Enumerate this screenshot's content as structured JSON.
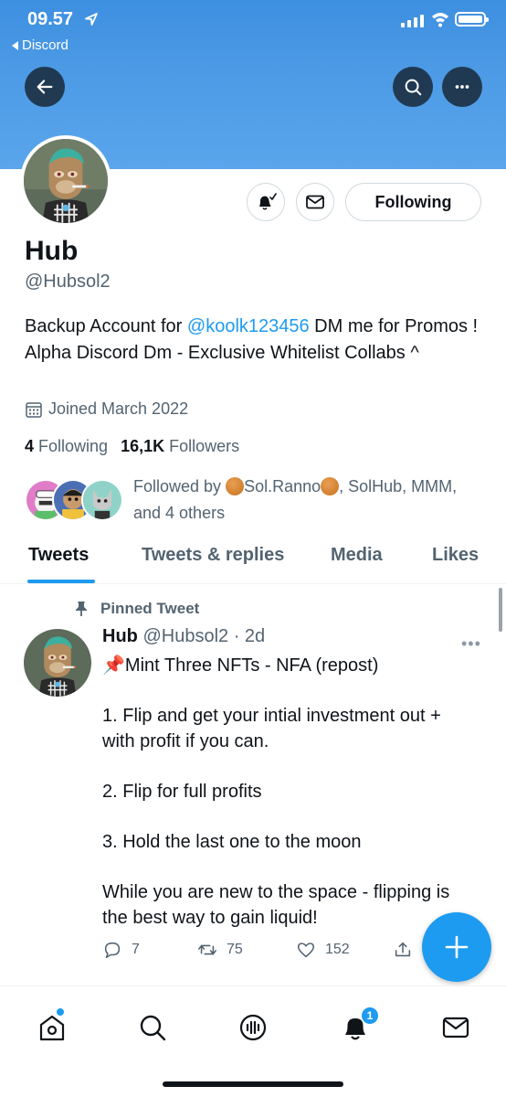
{
  "status_bar": {
    "time": "09.57",
    "back_app": "Discord"
  },
  "colors": {
    "accent": "#1d9bf0",
    "banner": "#4d9be6",
    "text_secondary": "#536471"
  },
  "header": {
    "back_icon": "arrow-left-icon",
    "search_icon": "search-icon",
    "more_icon": "more-icon"
  },
  "profile": {
    "name": "Hub",
    "handle": "@Hubsol2",
    "bio_before": "Backup Account for ",
    "bio_mention": "@koolk123456",
    "bio_after": " DM me for Promos ! Alpha Discord Dm - Exclusive Whitelist Collabs ^",
    "joined": "Joined March 2022",
    "following_count": "4",
    "following_label": "Following",
    "followers_count": "16,1K",
    "followers_label": "Followers",
    "following_button": "Following",
    "followed_by_prefix": "Followed by ",
    "followed_by_name1": "Sol.Ranno",
    "followed_by_rest": ", SolHub, MMM, and 4 others"
  },
  "tabs": [
    {
      "label": "Tweets",
      "active": true
    },
    {
      "label": "Tweets & replies",
      "active": false
    },
    {
      "label": "Media",
      "active": false
    },
    {
      "label": "Likes",
      "active": false
    }
  ],
  "tweet": {
    "pinned_label": "Pinned Tweet",
    "author_name": "Hub",
    "author_meta": "@Hubsol2 · 2d",
    "lines": [
      "📌Mint Three NFTs - NFA (repost)",
      "1. Flip and get your intial investment out + with profit if you can.",
      "2. Flip for full profits",
      "3. Hold the last one to the moon",
      "While you are new to the space - flipping is the best way to gain liquid!"
    ],
    "replies": "7",
    "retweets": "75",
    "likes": "152"
  },
  "bottom_nav": {
    "notifications_badge": "1",
    "items": [
      "home-icon",
      "search-icon",
      "spaces-icon",
      "notifications-icon",
      "messages-icon"
    ]
  }
}
